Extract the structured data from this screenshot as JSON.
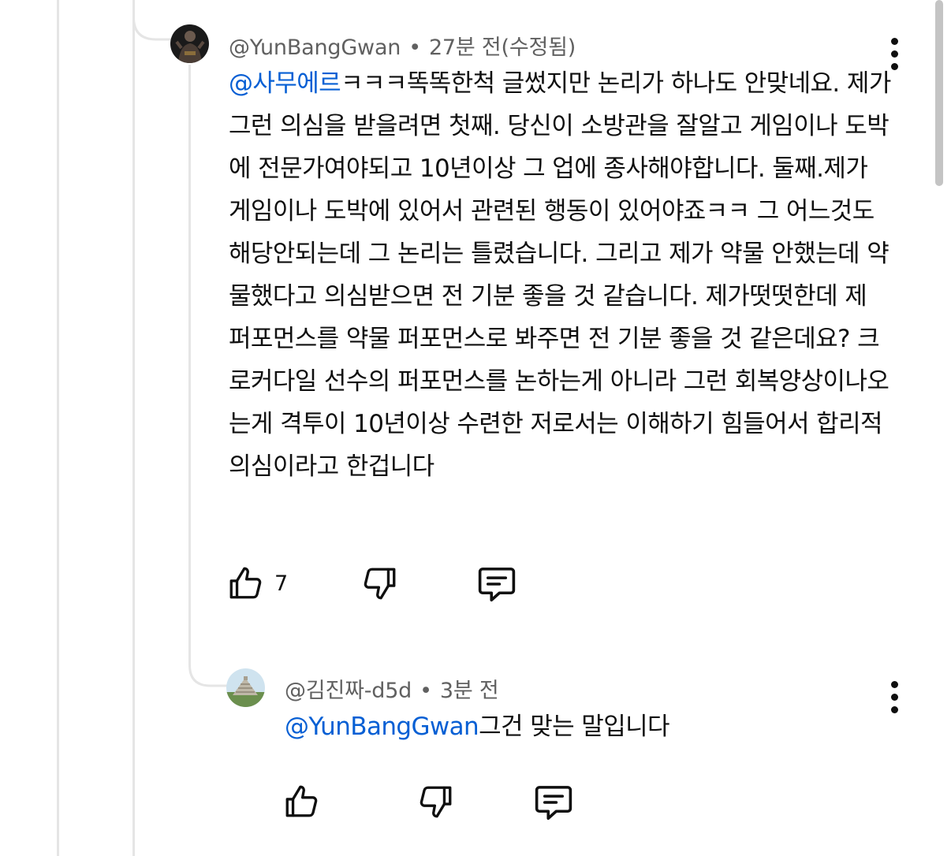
{
  "comment": {
    "author": "@YunBangGwan",
    "separator": "•",
    "time": "27분 전(수정됨)",
    "mention": "@사무에르",
    "body": "ㅋㅋㅋ똑똑한척 글썼지만 논리가 하나도 안맞네요. 제가 그런 의심을 받을려면 첫째. 당신이 소방관을 잘알고 게임이나 도박에 전문가여야되고 10년이상 그 업에 종사해야합니다. 둘째.제가 게임이나 도박에 있어서 관련된 행동이 있어야죠ㅋㅋ 그 어느것도 해당안되는데 그 논리는 틀렸습니다. 그리고 제가 약물 안했는데 약물했다고 의심받으면 전 기분 좋을 것 같습니다. 제가떳떳한데 제 퍼포먼스를 약물 퍼포먼스로 봐주면 전 기분 좋을 것 같은데요? 크로커다일 선수의 퍼포먼스를 논하는게 아니라 그런 회복양상이나오는게 격투이 10년이상 수련한 저로서는 이해하기 힘들어서 합리적 의심이라고 한겁니다",
    "like_count": "7",
    "like_icon": "thumbs-up-icon",
    "dislike_icon": "thumbs-down-icon",
    "reply_icon": "comment-icon"
  },
  "reply": {
    "author": "@김진짜-d5d",
    "separator": "•",
    "time": "3분 전",
    "mention": "@YunBangGwan",
    "body": "그건 맞는 말입니다",
    "like_icon": "thumbs-up-icon",
    "dislike_icon": "thumbs-down-icon",
    "reply_icon": "comment-icon"
  },
  "colors": {
    "mention": "#065fd4",
    "meta": "#606060",
    "thread_line": "#e5e5e5"
  }
}
